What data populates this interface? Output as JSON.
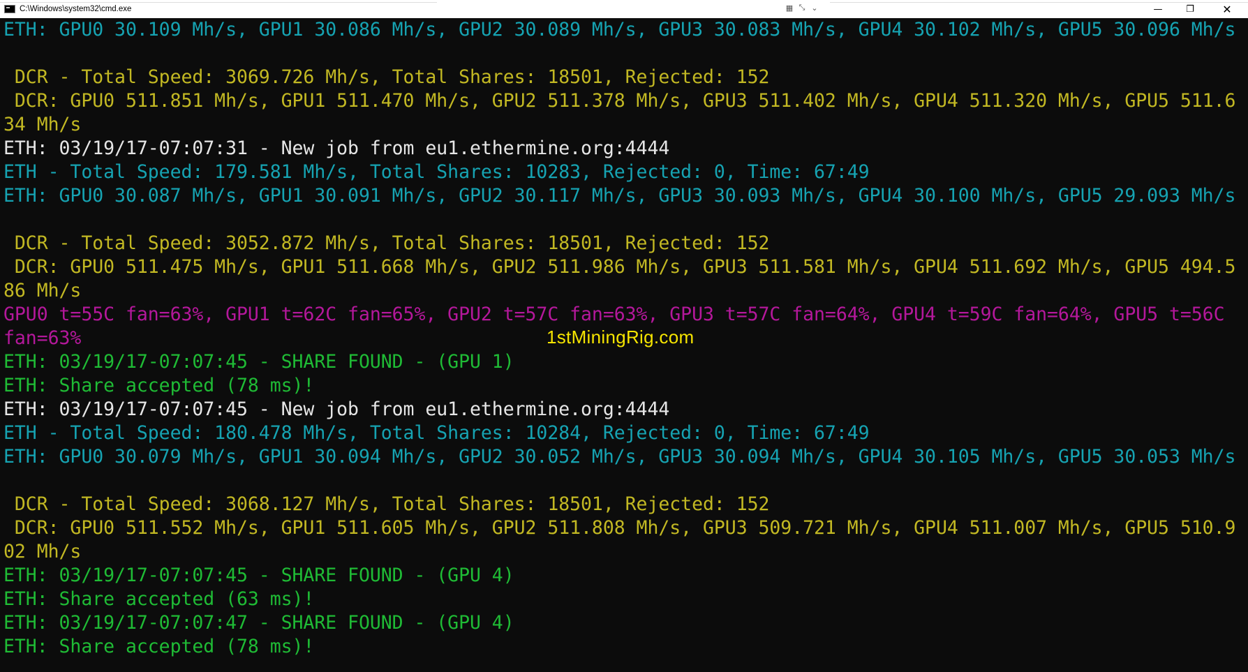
{
  "window": {
    "title": "C:\\Windows\\system32\\cmd.exe",
    "controls": {
      "minimize": "—",
      "restore": "❐",
      "close": "✕"
    }
  },
  "watermark": "1stMiningRig.com",
  "colors": {
    "eth_stats": "#16a3b2",
    "dcr_stats": "#c2b823",
    "job": "#e6e6e6",
    "gpu_temp": "#b4189b",
    "share": "#1fbb35"
  },
  "console": {
    "lines": [
      {
        "color": "cyan",
        "text": "ETH: GPU0 30.109 Mh/s, GPU1 30.086 Mh/s, GPU2 30.089 Mh/s, GPU3 30.083 Mh/s, GPU4 30.102 Mh/s, GPU5 30.096 Mh/s"
      },
      {
        "color": "cyan",
        "text": ""
      },
      {
        "color": "yellow",
        "text": " DCR - Total Speed: 3069.726 Mh/s, Total Shares: 18501, Rejected: 152"
      },
      {
        "color": "yellow",
        "text": " DCR: GPU0 511.851 Mh/s, GPU1 511.470 Mh/s, GPU2 511.378 Mh/s, GPU3 511.402 Mh/s, GPU4 511.320 Mh/s, GPU5 511.6"
      },
      {
        "color": "yellow",
        "text": "34 Mh/s"
      },
      {
        "color": "white",
        "text": "ETH: 03/19/17-07:07:31 - New job from eu1.ethermine.org:4444"
      },
      {
        "color": "cyan",
        "text": "ETH - Total Speed: 179.581 Mh/s, Total Shares: 10283, Rejected: 0, Time: 67:49"
      },
      {
        "color": "cyan",
        "text": "ETH: GPU0 30.087 Mh/s, GPU1 30.091 Mh/s, GPU2 30.117 Mh/s, GPU3 30.093 Mh/s, GPU4 30.100 Mh/s, GPU5 29.093 Mh/s"
      },
      {
        "color": "cyan",
        "text": ""
      },
      {
        "color": "yellow",
        "text": " DCR - Total Speed: 3052.872 Mh/s, Total Shares: 18501, Rejected: 152"
      },
      {
        "color": "yellow",
        "text": " DCR: GPU0 511.475 Mh/s, GPU1 511.668 Mh/s, GPU2 511.986 Mh/s, GPU3 511.581 Mh/s, GPU4 511.692 Mh/s, GPU5 494.5"
      },
      {
        "color": "yellow",
        "text": "86 Mh/s"
      },
      {
        "color": "magenta",
        "text": "GPU0 t=55C fan=63%, GPU1 t=62C fan=65%, GPU2 t=57C fan=63%, GPU3 t=57C fan=64%, GPU4 t=59C fan=64%, GPU5 t=56C"
      },
      {
        "color": "magenta",
        "text": "fan=63%"
      },
      {
        "color": "green",
        "text": "ETH: 03/19/17-07:07:45 - SHARE FOUND - (GPU 1)"
      },
      {
        "color": "green",
        "text": "ETH: Share accepted (78 ms)!"
      },
      {
        "color": "white",
        "text": "ETH: 03/19/17-07:07:45 - New job from eu1.ethermine.org:4444"
      },
      {
        "color": "cyan",
        "text": "ETH - Total Speed: 180.478 Mh/s, Total Shares: 10284, Rejected: 0, Time: 67:49"
      },
      {
        "color": "cyan",
        "text": "ETH: GPU0 30.079 Mh/s, GPU1 30.094 Mh/s, GPU2 30.052 Mh/s, GPU3 30.094 Mh/s, GPU4 30.105 Mh/s, GPU5 30.053 Mh/s"
      },
      {
        "color": "cyan",
        "text": ""
      },
      {
        "color": "yellow",
        "text": " DCR - Total Speed: 3068.127 Mh/s, Total Shares: 18501, Rejected: 152"
      },
      {
        "color": "yellow",
        "text": " DCR: GPU0 511.552 Mh/s, GPU1 511.605 Mh/s, GPU2 511.808 Mh/s, GPU3 509.721 Mh/s, GPU4 511.007 Mh/s, GPU5 510.9"
      },
      {
        "color": "yellow",
        "text": "02 Mh/s"
      },
      {
        "color": "green",
        "text": "ETH: 03/19/17-07:07:45 - SHARE FOUND - (GPU 4)"
      },
      {
        "color": "green",
        "text": "ETH: Share accepted (63 ms)!"
      },
      {
        "color": "green",
        "text": "ETH: 03/19/17-07:07:47 - SHARE FOUND - (GPU 4)"
      },
      {
        "color": "green",
        "text": "ETH: Share accepted (78 ms)!"
      }
    ]
  }
}
